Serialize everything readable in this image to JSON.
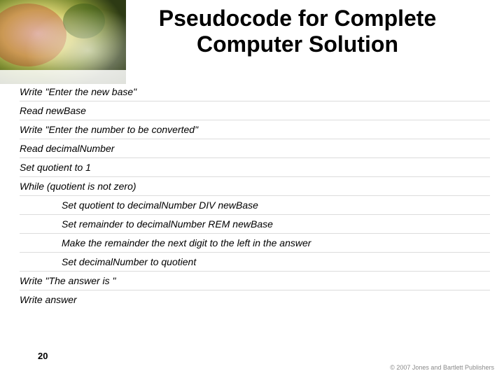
{
  "title": "Pseudocode for Complete Computer Solution",
  "code": {
    "l0": "Write \"Enter the new base\"",
    "l1": "Read newBase",
    "l2": "Write \"Enter the number to be converted\"",
    "l3": "Read decimalNumber",
    "l4": "Set quotient to 1",
    "l5": "While (quotient is not zero)",
    "l6": "Set quotient to decimalNumber DIV newBase",
    "l7": "Set remainder to decimalNumber REM newBase",
    "l8": "Make the remainder the next digit to the left in the answer",
    "l9": "Set decimalNumber to quotient",
    "l10": "Write \"The answer is \"",
    "l11": "Write answer"
  },
  "page_number": "20",
  "copyright": "© 2007 Jones and Bartlett Publishers"
}
